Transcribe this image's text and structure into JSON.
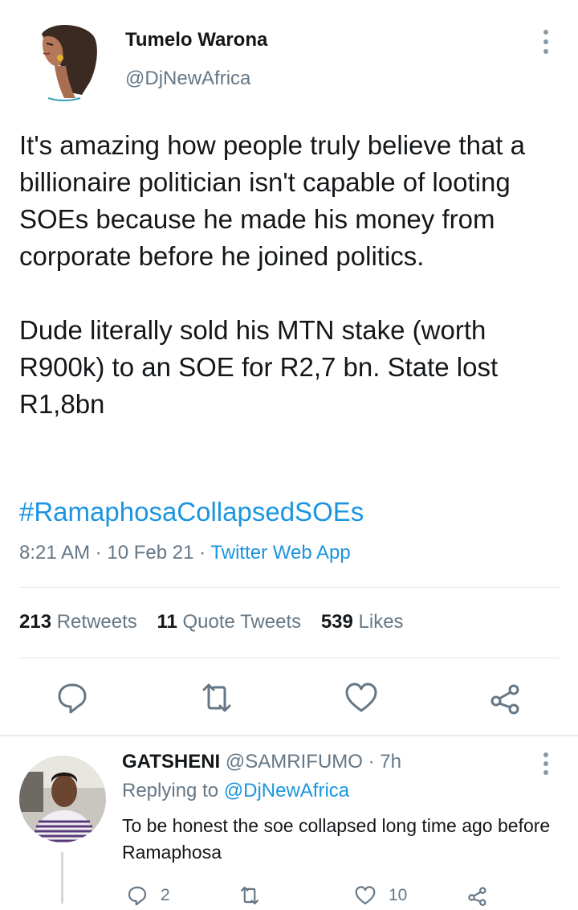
{
  "tweet": {
    "author_name": "Tumelo Warona",
    "author_handle": "@DjNewAfrica",
    "paragraph1": "It's amazing how people truly believe that a billionaire politician isn't capable of looting SOEs because he made his money from corporate before he joined politics.",
    "paragraph2": "Dude literally sold his MTN stake (worth R900k) to an SOE for R2,7 bn. State lost R1,8bn",
    "hashtag": "#RamaphosaCollapsedSOEs",
    "time": "8:21 AM",
    "date": "10 Feb 21",
    "source": "Twitter Web App",
    "separator": "·"
  },
  "stats": {
    "retweets_count": "213",
    "retweets_label": "Retweets",
    "quotes_count": "11",
    "quotes_label": "Quote Tweets",
    "likes_count": "539",
    "likes_label": "Likes"
  },
  "actions": [
    "reply-icon",
    "retweet-icon",
    "like-icon",
    "share-icon"
  ],
  "reply": {
    "author_name": "GATSHENI",
    "author_handle": "@SAMRIFUMO",
    "separator": "·",
    "age": "7h",
    "replying_prefix": "Replying to",
    "replying_to": "@DjNewAfrica",
    "text": "To be honest the soe collapsed long time ago before Ramaphosa",
    "reply_count": "2",
    "retweet_count": "",
    "like_count": "10"
  },
  "colors": {
    "link": "#1b95e0",
    "secondary_text": "#657786",
    "primary_text": "#14171a",
    "divider": "#e6ecf0"
  }
}
